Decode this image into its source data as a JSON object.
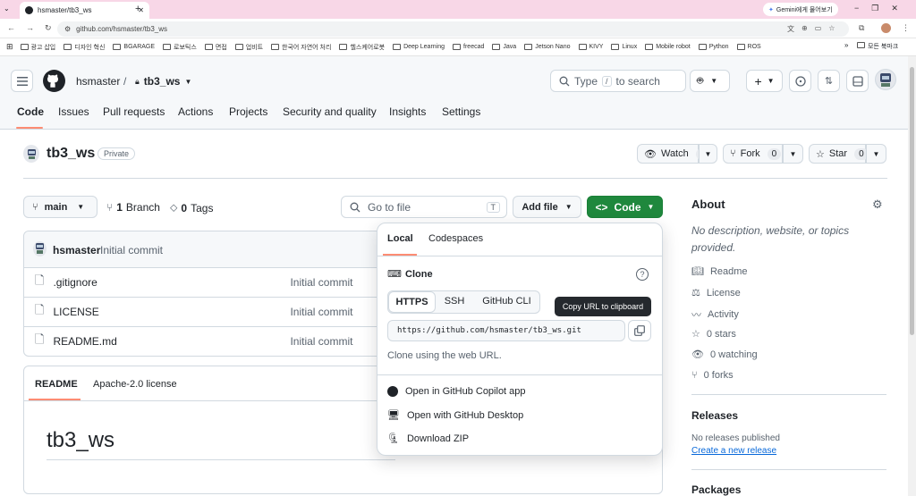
{
  "browser": {
    "tab_title": "hsmaster/tb3_ws",
    "url": "github.com/hsmaster/tb3_ws",
    "gemini": "Gemini에게 물어보기",
    "bookmarks": [
      "광고 삽입",
      "디자인 혁신",
      "BGARAGE",
      "로보틱스",
      "면접",
      "업비트",
      "한국어 자연어 처리",
      "헬스케어로봇",
      "Deep Learning",
      "freecad",
      "Java",
      "Jetson Nano",
      "KIVY",
      "Linux",
      "Mobile robot",
      "Python",
      "ROS"
    ],
    "all_bookmarks": "모든 북마크"
  },
  "header": {
    "owner": "hsmaster",
    "sep": "/",
    "repo": "tb3_ws",
    "search_type": "Type",
    "search_key": "/",
    "search_rest": "to search"
  },
  "nav": {
    "tabs": [
      "Code",
      "Issues",
      "Pull requests",
      "Actions",
      "Projects",
      "Security and quality",
      "Insights",
      "Settings"
    ]
  },
  "repo": {
    "name": "tb3_ws",
    "visibility": "Private",
    "watch": "Watch",
    "watch_count": "0",
    "fork": "Fork",
    "fork_count": "0",
    "star": "Star",
    "star_count": "0"
  },
  "filebar": {
    "branch": "main",
    "branches_count": "1",
    "branches_label": "Branch",
    "tags_count": "0",
    "tags_label": "Tags",
    "goto_placeholder": "Go to file",
    "goto_key": "T",
    "add_file": "Add file",
    "code": "Code"
  },
  "commit": {
    "author": "hsmaster",
    "message": "Initial commit"
  },
  "files": [
    {
      "name": ".gitignore",
      "commit": "Initial commit"
    },
    {
      "name": "LICENSE",
      "commit": "Initial commit"
    },
    {
      "name": "README.md",
      "commit": "Initial commit"
    }
  ],
  "readme": {
    "tab1": "README",
    "tab2": "Apache-2.0 license",
    "heading": "tb3_ws"
  },
  "about": {
    "title": "About",
    "description": "No description, website, or topics provided.",
    "readme": "Readme",
    "license": "License",
    "activity": "Activity",
    "stars": "0 stars",
    "watching": "0 watching",
    "forks": "0 forks",
    "releases_title": "Releases",
    "no_releases": "No releases published",
    "create_release": "Create a new release",
    "packages_title": "Packages"
  },
  "popover": {
    "tab_local": "Local",
    "tab_codespaces": "Codespaces",
    "clone_title": "Clone",
    "proto": [
      "HTTPS",
      "SSH",
      "GitHub CLI"
    ],
    "url": "https://github.com/hsmaster/tb3_ws.git",
    "hint": "Clone using the web URL.",
    "tooltip": "Copy URL to clipboard",
    "copilot": "Open in GitHub Copilot app",
    "desktop": "Open with GitHub Desktop",
    "zip": "Download ZIP"
  },
  "colors": {
    "accent": "#fd8c73",
    "green": "#1f883d",
    "link": "#0969da"
  }
}
